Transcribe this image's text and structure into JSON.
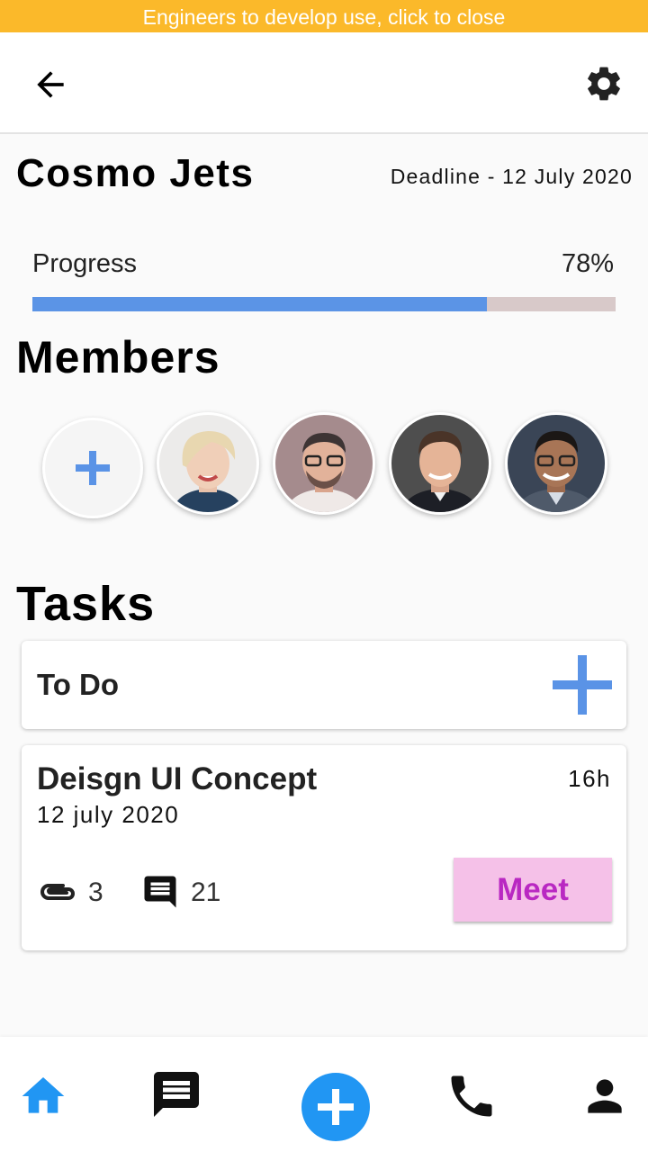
{
  "banner": {
    "text": "Engineers to develop use, click to close"
  },
  "appbar": {
    "back_icon": "arrow-back-icon",
    "settings_icon": "gear-icon"
  },
  "project": {
    "name": "Cosmo Jets",
    "deadline": "Deadline - 12 July 2020",
    "progress_label": "Progress",
    "progress_text": "78%",
    "progress_value": 0.78
  },
  "members": {
    "heading": "Members",
    "add_icon": "plus-icon",
    "avatars": [
      "member-1",
      "member-2",
      "member-3",
      "member-4"
    ]
  },
  "tasks": {
    "heading": "Tasks",
    "todo_label": "To Do",
    "items": [
      {
        "title": "Deisgn UI Concept",
        "date": "12 july 2020",
        "hours": "16h",
        "attachments": "3",
        "comments": "21",
        "action_label": "Meet"
      }
    ]
  },
  "colors": {
    "banner": "#fbb92a",
    "progress_fill": "#5b94e6",
    "progress_track": "#d8c9c9",
    "accent_blue": "#2196f3",
    "meet_bg": "#f5c1e8",
    "meet_text": "#b928c2"
  },
  "bottom_nav": {
    "items": [
      "home-icon",
      "chat-icon",
      "add-circle-icon",
      "phone-icon",
      "person-icon"
    ]
  }
}
